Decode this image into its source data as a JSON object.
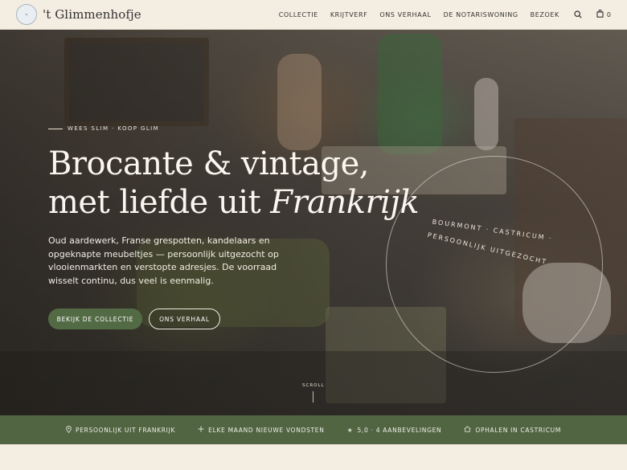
{
  "header": {
    "logo_text": "GLIMMENHOFJE",
    "brand": "'t Glimmenhofje",
    "nav": [
      "COLLECTIE",
      "KRIJTVERF",
      "ONS VERHAAL",
      "DE NOTARISWONING",
      "BEZOEK"
    ],
    "search_icon": "search-icon",
    "cart_icon": "bag-icon",
    "cart_count": "0"
  },
  "hero": {
    "tagline": "WEES SLIM · KOOP GLIM",
    "headline_line1": "Brocante & vintage,",
    "headline_line2_pre": "met liefde uit ",
    "headline_line2_em": "Frankrijk",
    "lead": "Oud aardewerk, Franse grespotten, kandelaars en opgeknapte meubeltjes — persoonlijk uitgezocht op vlooienmarkten en verstopte adresjes. De voorraad wisselt continu, dus veel is eenmalig.",
    "primary_button": "BEKIJK DE COLLECTIE",
    "secondary_button": "ONS VERHAAL",
    "seal_line1": "BOURMONT · CASTRICUM ·",
    "seal_line2": "PERSOONLIJK UITGEZOCHT",
    "scroll_label": "SCROLL"
  },
  "features": [
    {
      "icon": "map-pin-icon",
      "label": "PERSOONLIJK UIT FRANKRIJK"
    },
    {
      "icon": "plus-icon",
      "label": "ELKE MAAND NIEUWE VONDSTEN"
    },
    {
      "icon": "star-icon",
      "label": "5,0 · 4 AANBEVELINGEN"
    },
    {
      "icon": "home-icon",
      "label": "OPHALEN IN CASTRICUM"
    }
  ],
  "colors": {
    "accent_green": "#536b45",
    "background_cream": "#f4ede2"
  }
}
